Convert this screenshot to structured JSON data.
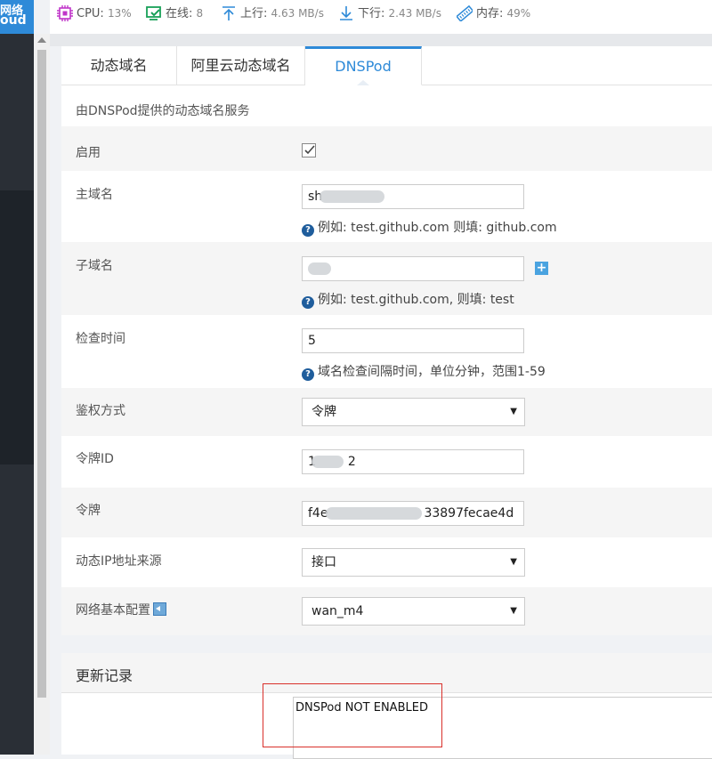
{
  "brand": {
    "line1": "网络",
    "line2": "oud"
  },
  "topbar": {
    "cpu_label": "CPU:",
    "cpu_value": "13%",
    "online_label": "在线:",
    "online_value": "8",
    "up_label": "上行:",
    "up_value": "4.63 MB/s",
    "down_label": "下行:",
    "down_value": "2.43 MB/s",
    "mem_label": "内存:",
    "mem_value": "49%"
  },
  "tabs": [
    {
      "label": "动态域名"
    },
    {
      "label": "阿里云动态域名"
    },
    {
      "label": "DNSPod",
      "active": true
    }
  ],
  "description": "由DNSPod提供的动态域名服务",
  "form": {
    "enable": {
      "label": "启用",
      "checked": true
    },
    "domain": {
      "label": "主域名",
      "value": "sh",
      "hint": "例如: test.github.com 则填: github.com"
    },
    "subdomain": {
      "label": "子域名",
      "value": "",
      "hint": "例如: test.github.com, 则填: test"
    },
    "interval": {
      "label": "检查时间",
      "value": "5",
      "hint": "域名检查间隔时间，单位分钟，范围1-59"
    },
    "auth": {
      "label": "鉴权方式",
      "selected": "令牌"
    },
    "token_id": {
      "label": "令牌ID",
      "value_start": "1",
      "value_end": "2"
    },
    "token": {
      "label": "令牌",
      "value_start": "f4e",
      "value_end": "33897fecae4d"
    },
    "ip_source": {
      "label": "动态IP地址来源",
      "selected": "接口"
    },
    "network": {
      "label": "网络基本配置",
      "selected": "wan_m4"
    }
  },
  "log": {
    "title": "更新记录",
    "text": "DNSPod NOT ENABLED"
  },
  "colors": {
    "accent": "#2e8ad8",
    "sidebar": "#2a2f36",
    "highlight": "#d9302b"
  }
}
